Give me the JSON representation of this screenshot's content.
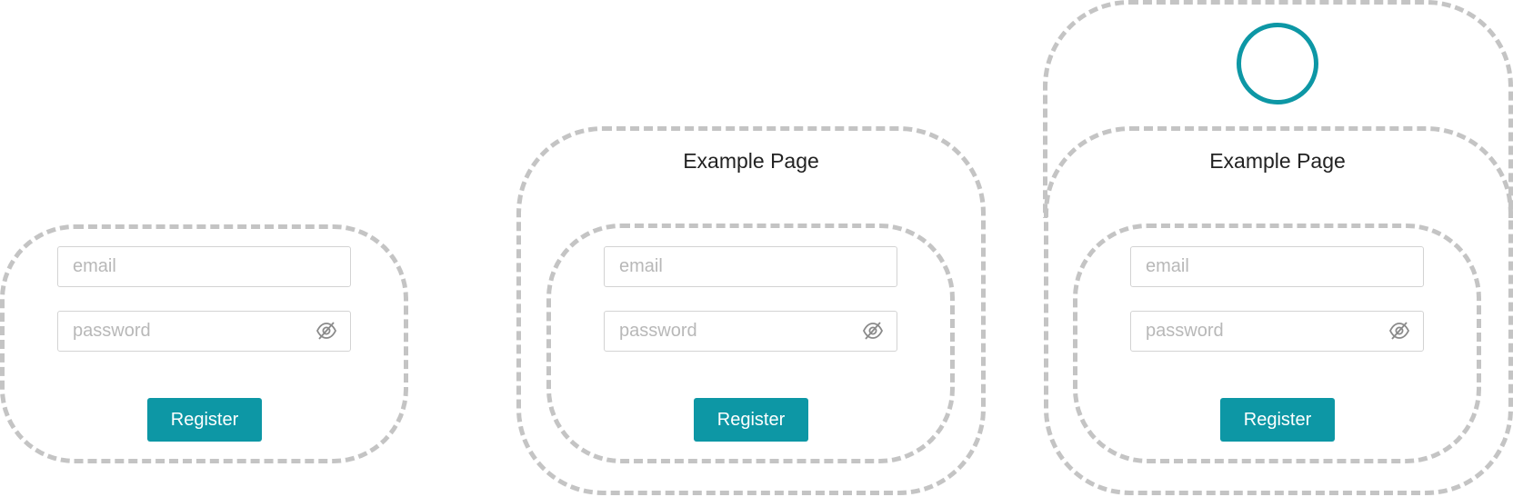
{
  "colors": {
    "accent": "#0d97a5",
    "dashed_border": "#c4c4c4",
    "field_border": "#d3d3d3",
    "placeholder": "#b8b8b8"
  },
  "panels": [
    {
      "email_placeholder": "email",
      "password_placeholder": "password",
      "eye_icon": "eye-off-icon",
      "button_label": "Register"
    },
    {
      "title": "Example Page",
      "email_placeholder": "email",
      "password_placeholder": "password",
      "eye_icon": "eye-off-icon",
      "button_label": "Register"
    },
    {
      "avatar_icon": "avatar-circle",
      "title": "Example Page",
      "email_placeholder": "email",
      "password_placeholder": "password",
      "eye_icon": "eye-off-icon",
      "button_label": "Register"
    }
  ]
}
